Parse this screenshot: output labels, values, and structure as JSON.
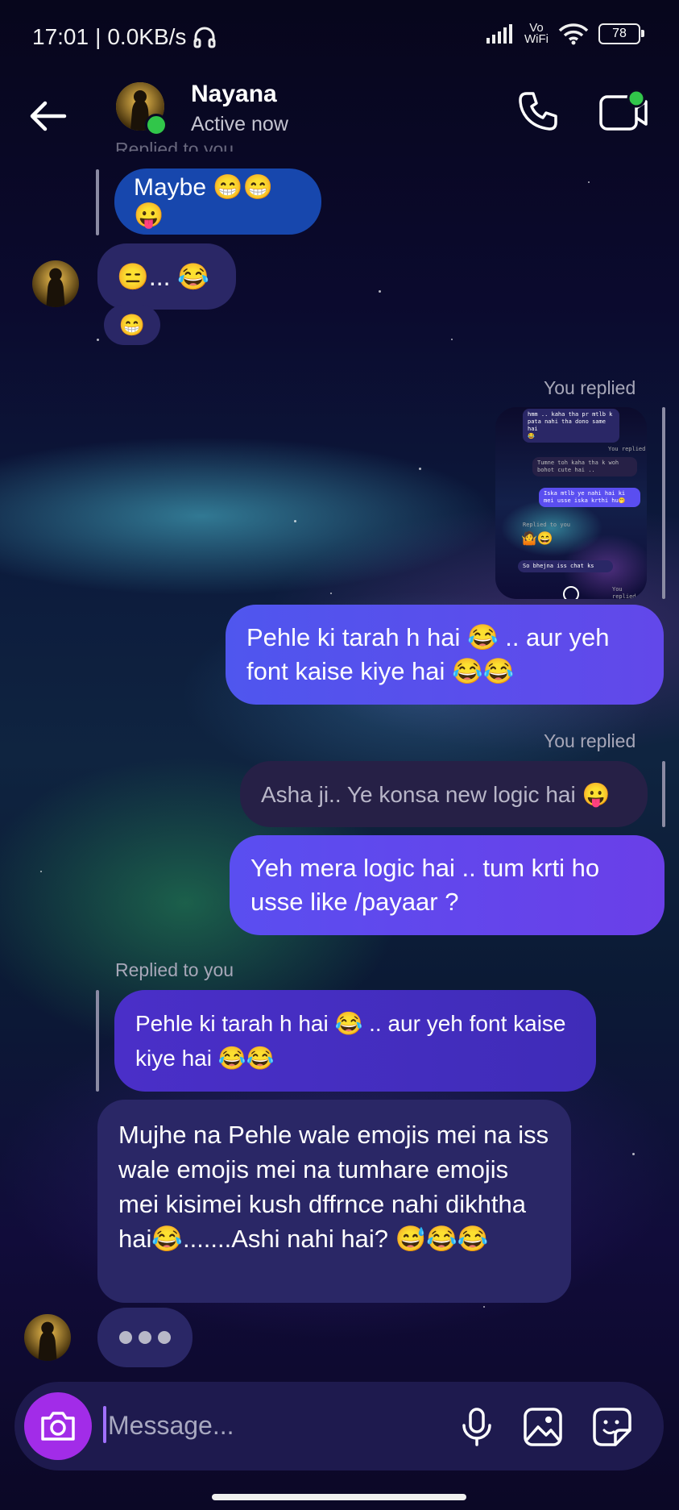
{
  "status_bar": {
    "time": "17:01",
    "separator": "|",
    "net_speed": "0.0KB/s",
    "vowifi_top": "Vo",
    "vowifi_bottom": "WiFi",
    "battery": "78"
  },
  "header": {
    "contact_name": "Nayana",
    "status": "Active now"
  },
  "messages": {
    "top_cutoff_label": "Replied to you",
    "maybe": "Maybe 😁😁😛",
    "them_reaction": "😑... 😂",
    "them_small": "😁",
    "you_replied_1": "You replied",
    "thumb": {
      "line1": "hmm .. kaha tha pr mtlb k",
      "line2": "pata nahi tha dono same hai",
      "emoji": "😂",
      "you_replied": "You replied",
      "q1": "Tumne toh kaha tha k woh bohot cute hai ..",
      "q2": "Iska mtlb ye nahi hai ki mei usse iska krthi hu🤭",
      "replied_to_you": "Replied to you",
      "emoji2": "🤷😄",
      "q3": "So bhejna iss chat ks",
      "you_replied2": "You replied"
    },
    "me_1": "Pehle ki tarah h hai 😂 .. aur yeh font kaise kiye hai 😂😂",
    "you_replied_2": "You replied",
    "quote_1": "Asha ji.. Ye konsa new logic hai 😛",
    "me_2": "Yeh mera logic hai .. tum krti ho usse like /payaar ?",
    "replied_to_you": "Replied to you",
    "quote_2": "Pehle ki tarah h hai 😂 .. aur yeh font kaise kiye hai 😂😂",
    "them_long": "Mujhe na Pehle wale emojis mei na iss wale emojis mei na tumhare emojis mei kisimei kush dffrnce nahi dikhtha hai😂.......Ashi nahi hai? 😅😂😂"
  },
  "composer": {
    "placeholder": "Message..."
  },
  "colors": {
    "accent": "#a22ce8",
    "online": "#31c64a",
    "bubble_me": "#5a4ef0",
    "bubble_them": "#2a2766"
  }
}
